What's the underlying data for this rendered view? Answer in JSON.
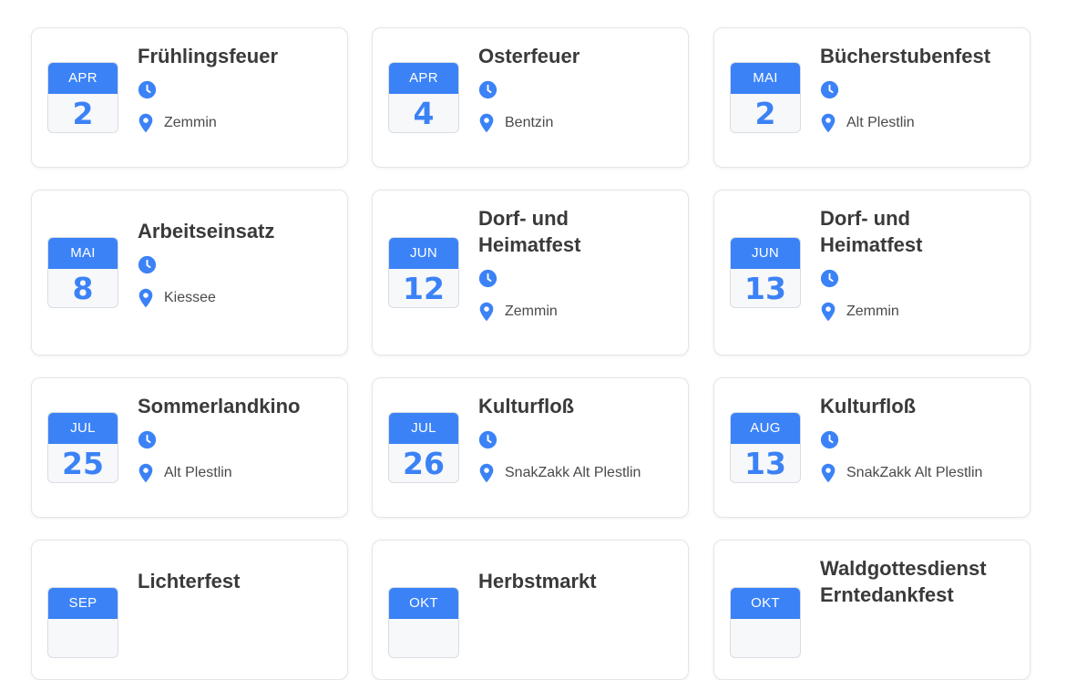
{
  "colors": {
    "accent": "#3b82f6",
    "text": "#3a3a3a",
    "border": "#e3e5e8"
  },
  "icons": {
    "time": "clock-icon",
    "location": "map-pin-icon"
  },
  "events": [
    {
      "month": "APR",
      "day": "2",
      "title": "Frühlingsfeuer",
      "location": "Zemmin"
    },
    {
      "month": "APR",
      "day": "4",
      "title": "Osterfeuer",
      "location": "Bentzin"
    },
    {
      "month": "MAI",
      "day": "2",
      "title": "Bücherstubenfest",
      "location": "Alt Plestlin"
    },
    {
      "month": "MAI",
      "day": "8",
      "title": "Arbeitseinsatz",
      "location": "Kiessee"
    },
    {
      "month": "JUN",
      "day": "12",
      "title": "Dorf- und Heimatfest",
      "location": "Zemmin"
    },
    {
      "month": "JUN",
      "day": "13",
      "title": "Dorf- und Heimatfest",
      "location": "Zemmin"
    },
    {
      "month": "JUL",
      "day": "25",
      "title": "Sommerlandkino",
      "location": "Alt Plestlin"
    },
    {
      "month": "JUL",
      "day": "26",
      "title": "Kulturfloß",
      "location": "SnakZakk Alt Plestlin"
    },
    {
      "month": "AUG",
      "day": "13",
      "title": "Kulturfloß",
      "location": "SnakZakk Alt Plestlin"
    },
    {
      "month": "SEP",
      "day": "",
      "title": "Lichterfest",
      "location": ""
    },
    {
      "month": "OKT",
      "day": "",
      "title": "Herbstmarkt",
      "location": ""
    },
    {
      "month": "OKT",
      "day": "",
      "title": "Waldgottesdienst Erntedankfest",
      "location": ""
    }
  ]
}
